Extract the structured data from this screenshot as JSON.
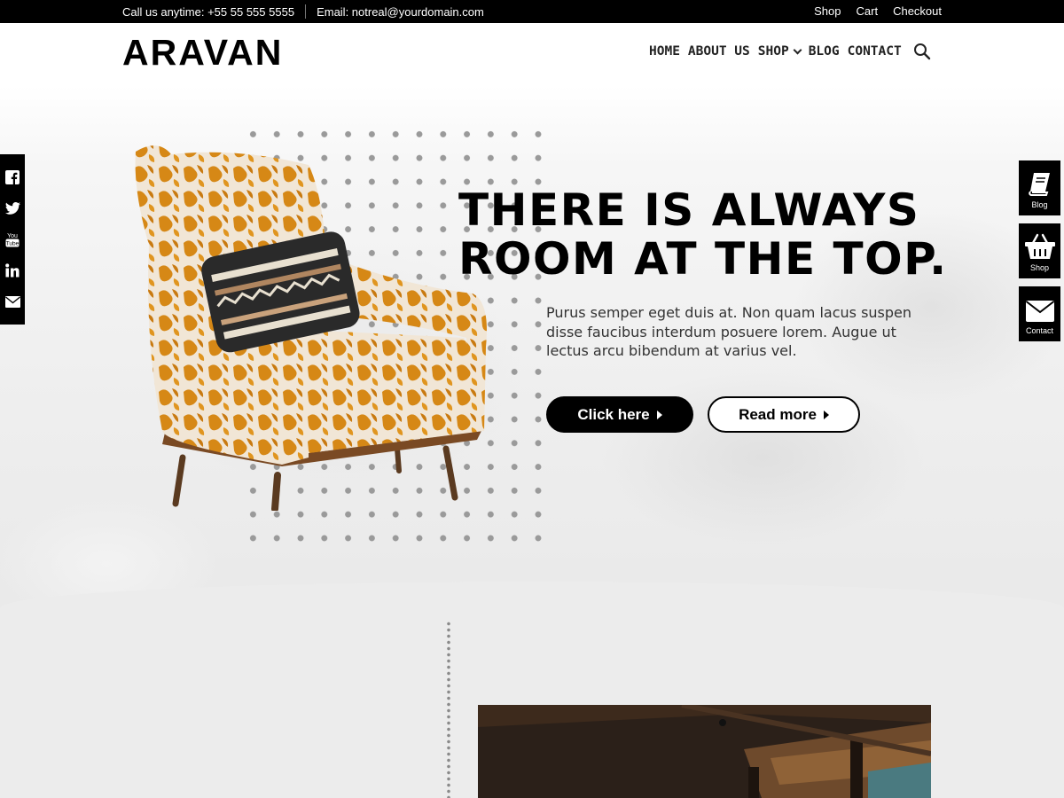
{
  "topbar": {
    "phone": "Call us anytime: +55 55 555 5555",
    "email": "Email: notreal@yourdomain.com",
    "links": [
      "Shop",
      "Cart",
      "Checkout"
    ]
  },
  "header": {
    "logo": "ARAVAN",
    "nav": [
      "HOME",
      "ABOUT US",
      "SHOP",
      "BLOG",
      "CONTACT"
    ],
    "search_icon": "search-icon"
  },
  "hero": {
    "headline_line1": "THERE IS ALWAYS",
    "headline_line2": "ROOM AT THE TOP.",
    "subtext": "Purus semper eget duis at. Non quam lacus suspen disse faucibus interdum posuere lorem. Augue ut lectus arcu bibendum at varius vel.",
    "primary_button": "Click here",
    "secondary_button": "Read more"
  },
  "social": [
    "facebook-icon",
    "twitter-icon",
    "youtube-icon",
    "linkedin-icon",
    "mail-icon"
  ],
  "quick_links": [
    {
      "label": "Blog",
      "icon": "book-icon"
    },
    {
      "label": "Shop",
      "icon": "basket-icon"
    },
    {
      "label": "Contact",
      "icon": "envelope-icon"
    }
  ],
  "colors": {
    "accent": "#000000",
    "chair_orange": "#d98c1a",
    "background": "#ececec"
  }
}
